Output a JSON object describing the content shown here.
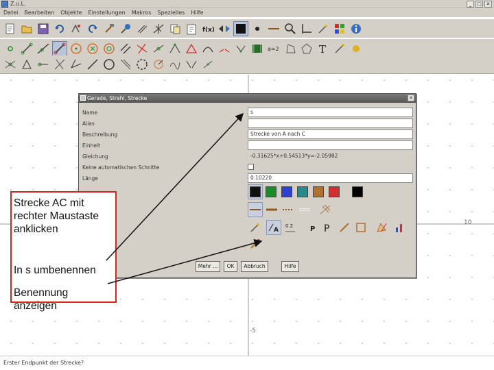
{
  "window": {
    "title": "Z.u.L.",
    "buttons": [
      "_",
      "□",
      "✕"
    ]
  },
  "menubar": {
    "items": [
      "Datei",
      "Bearbeiten",
      "Objekte",
      "Einstellungen",
      "Makros",
      "Spezielles",
      "Hilfe"
    ]
  },
  "toolbar_row1": {
    "fx_label": "f(x)"
  },
  "toolbar_row2": {
    "ab_label": "a=2",
    "t_label": "T"
  },
  "dialog": {
    "title": "Gerade, Strahl, Strecke",
    "fields": [
      {
        "label": "Name",
        "value": "s"
      },
      {
        "label": "Alias",
        "value": ""
      },
      {
        "label": "Beschreibung",
        "value": "Strecke von A nach C"
      },
      {
        "label": "Einheit",
        "value": ""
      },
      {
        "label": "Gleichung",
        "value": "-0.31625*x+0.54513*y=-2.05982"
      },
      {
        "label": "Keine automatischen Schnitte",
        "value": ""
      },
      {
        "label": "Länge",
        "value": "0.10220"
      }
    ],
    "colors": [
      "#111111",
      "#1a8a2a",
      "#3040d0",
      "#2a8a8a",
      "#b07030",
      "#d03030",
      "#000000"
    ],
    "buttons": [
      "Mehr ...",
      "OK",
      "Abbruch",
      "Hilfe"
    ],
    "mini_labels": {
      "a2": "0.2",
      "p_small": "P",
      "p_large": "P"
    }
  },
  "callout": {
    "line1": "Strecke AC mit rechter Maustaste anklicken",
    "line2": "In s umbenennen",
    "line3": "Benennung anzeigen"
  },
  "axes": {
    "x_label": "10",
    "y_label": "-5"
  },
  "statusbar": {
    "text": "Erster Endpunkt der Strecke?"
  }
}
